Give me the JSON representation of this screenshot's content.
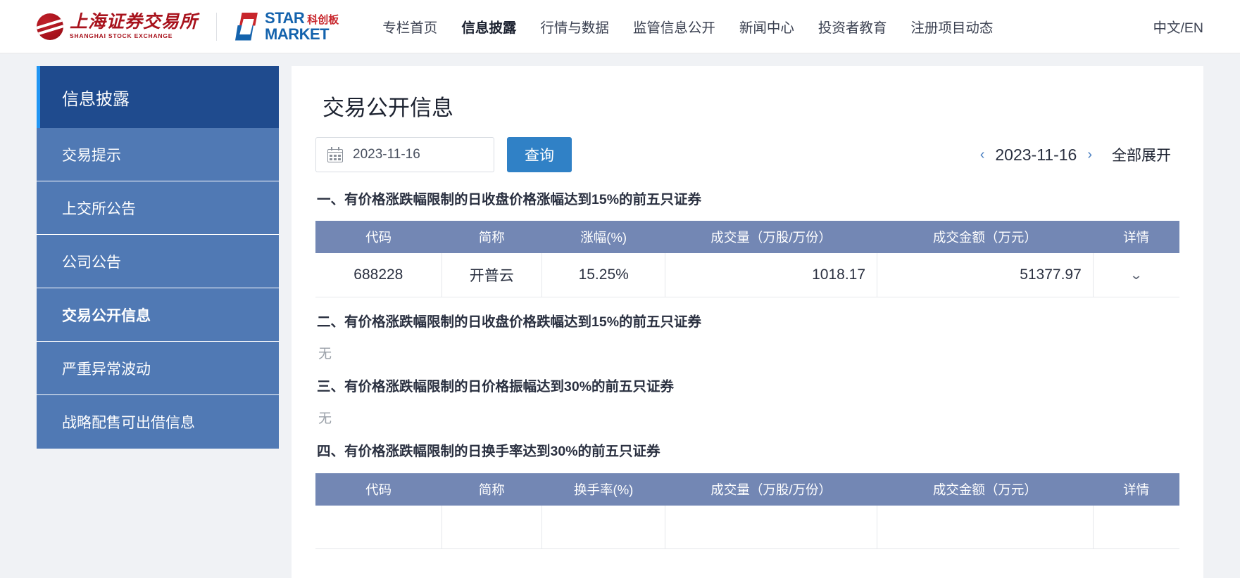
{
  "header": {
    "logos": {
      "sse_cn": "上海证券交易所",
      "sse_en": "SHANGHAI STOCK EXCHANGE",
      "star_word": "STAR",
      "star_cn": "科创板",
      "star_word2": "MARKET"
    },
    "nav": [
      {
        "label": "专栏首页",
        "active": false
      },
      {
        "label": "信息披露",
        "active": true
      },
      {
        "label": "行情与数据",
        "active": false
      },
      {
        "label": "监管信息公开",
        "active": false
      },
      {
        "label": "新闻中心",
        "active": false
      },
      {
        "label": "投资者教育",
        "active": false
      },
      {
        "label": "注册项目动态",
        "active": false
      }
    ],
    "lang": "中文/EN"
  },
  "sidebar": {
    "title": "信息披露",
    "items": [
      {
        "label": "交易提示",
        "active": false
      },
      {
        "label": "上交所公告",
        "active": false
      },
      {
        "label": "公司公告",
        "active": false
      },
      {
        "label": "交易公开信息",
        "active": true
      },
      {
        "label": "严重异常波动",
        "active": false
      },
      {
        "label": "战略配售可出借信息",
        "active": false
      }
    ]
  },
  "main": {
    "title": "交易公开信息",
    "toolbar": {
      "date_value": "2023-11-16",
      "date_placeholder": "2023-11-16",
      "query_label": "查询",
      "prev_label": "‹",
      "next_label": "›",
      "date_nav_value": "2023-11-16",
      "expand_all_label": "全部展开"
    },
    "sections": [
      {
        "title": "一、有价格涨跌幅限制的日收盘价格涨幅达到15%的前五只证券",
        "has_table": true,
        "empty_text": "",
        "columns": [
          "代码",
          "简称",
          "涨幅(%)",
          "成交量（万股/万份）",
          "成交金额（万元）",
          "详情"
        ],
        "rows": [
          {
            "code": "688228",
            "name": "开普云",
            "pct": "15.25%",
            "volume": "1018.17",
            "amount": "51377.97",
            "detail": "⌄"
          }
        ]
      },
      {
        "title": "二、有价格涨跌幅限制的日收盘价格跌幅达到15%的前五只证券",
        "has_table": false,
        "empty_text": "无",
        "columns": [],
        "rows": []
      },
      {
        "title": "三、有价格涨跌幅限制的日价格振幅达到30%的前五只证券",
        "has_table": false,
        "empty_text": "无",
        "columns": [],
        "rows": []
      },
      {
        "title": "四、有价格涨跌幅限制的日换手率达到30%的前五只证券",
        "has_table": true,
        "empty_text": "",
        "columns": [
          "代码",
          "简称",
          "换手率(%)",
          "成交量（万股/万份）",
          "成交金额（万元）",
          "详情"
        ],
        "rows": []
      }
    ]
  },
  "colors": {
    "brand_red": "#a8121c",
    "brand_blue": "#1463ad",
    "sidebar_head": "#1f4b8e",
    "sidebar_item": "#5079b4",
    "accent_bar": "#2196f3",
    "button_blue": "#3081c6",
    "table_head": "#7387b4"
  }
}
